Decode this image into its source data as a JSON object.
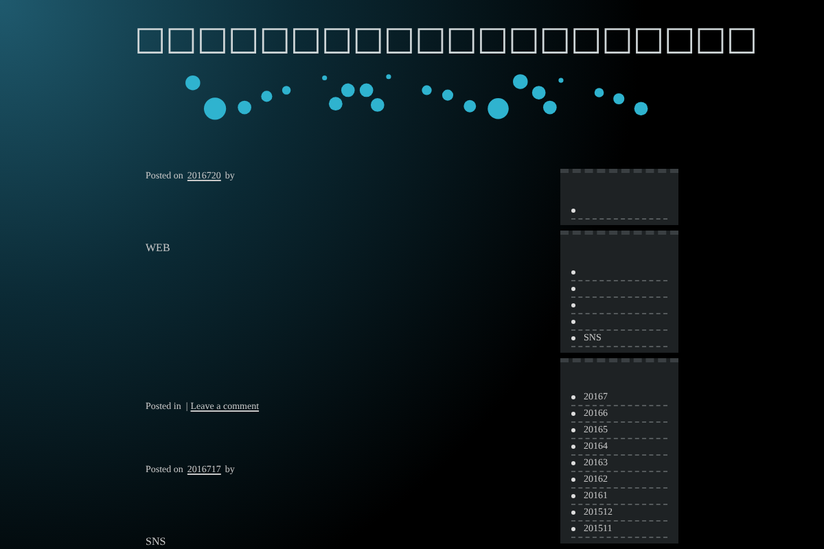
{
  "site_title": "□□□□□□□□□□□□□□□□□□□□",
  "posts": [
    {
      "meta_prefix": "Posted on",
      "date": "2016720",
      "meta_suffix": "by",
      "content": "WEB",
      "footer_prefix": "Posted in  |",
      "comment_link": "Leave a comment"
    },
    {
      "meta_prefix": "Posted on",
      "date": "2016717",
      "meta_suffix": "by",
      "content": "SNS"
    }
  ],
  "sidebar": {
    "widgets": [
      {
        "items": [
          {
            "kind": "blank"
          }
        ]
      },
      {
        "items": [
          {
            "kind": "blank"
          },
          {
            "kind": "blank"
          },
          {
            "kind": "blank"
          },
          {
            "kind": "blank"
          },
          {
            "kind": "link",
            "label": "SNS"
          }
        ]
      },
      {
        "items": [
          {
            "label": "20167"
          },
          {
            "label": "20166"
          },
          {
            "label": "20165"
          },
          {
            "label": "20164"
          },
          {
            "label": "20163"
          },
          {
            "label": "20162"
          },
          {
            "label": "20161"
          },
          {
            "label": "201512"
          },
          {
            "label": "201511"
          }
        ]
      }
    ]
  }
}
